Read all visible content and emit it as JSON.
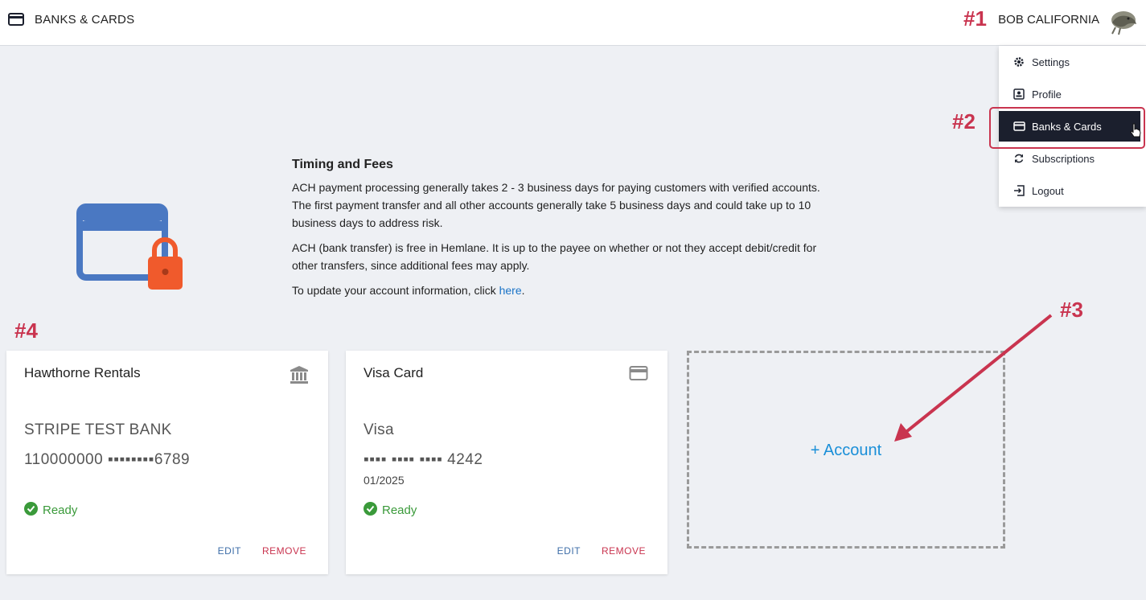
{
  "header": {
    "page_title": "BANKS & CARDS",
    "user_name": "BOB CALIFORNIA",
    "page_icon": "credit-card-icon",
    "avatar_icon": "avatar-image"
  },
  "annotations": {
    "a1": "#1",
    "a2": "#2",
    "a3": "#3",
    "a4": "#4",
    "color": "#c9344f"
  },
  "user_menu": {
    "items": [
      {
        "label": "Settings",
        "icon": "gear-icon"
      },
      {
        "label": "Profile",
        "icon": "profile-icon"
      },
      {
        "label": "Banks & Cards",
        "icon": "credit-card-icon",
        "active": true
      },
      {
        "label": "Subscriptions",
        "icon": "refresh-icon"
      },
      {
        "label": "Logout",
        "icon": "logout-icon"
      }
    ]
  },
  "info": {
    "heading": "Timing and Fees",
    "p1": "ACH payment processing generally takes 2 - 3 business days for paying customers with verified accounts.",
    "p1b": "The first payment transfer and all other accounts generally take 5 business days and could take up to 10",
    "p1c": "business days to address risk.",
    "p2": "ACH (bank transfer) is free in Hemlane. It is up to the payee on whether or not they accept debit/credit for",
    "p2b": "other transfers, since additional fees may apply.",
    "p3_prefix": "To update your account information, click ",
    "p3_link": "here",
    "p3_suffix": "."
  },
  "accounts": [
    {
      "title": "Hawthorne Rentals",
      "icon": "bank-icon",
      "name": "STRIPE TEST BANK",
      "number": "110000000 ▪▪▪▪▪▪▪▪6789",
      "status": "Ready",
      "edit": "EDIT",
      "remove": "REMOVE"
    },
    {
      "title": "Visa Card",
      "icon": "credit-card-icon",
      "name": "Visa",
      "number": "▪▪▪▪ ▪▪▪▪ ▪▪▪▪ 4242",
      "expiry": "01/2025",
      "status": "Ready",
      "edit": "EDIT",
      "remove": "REMOVE"
    }
  ],
  "add_account": {
    "label": "+ Account"
  },
  "colors": {
    "accent_blue": "#1a8fd8",
    "ready_green": "#3a9a3a",
    "remove_red": "#c9344f",
    "menu_active_bg": "#1b1f2d"
  }
}
